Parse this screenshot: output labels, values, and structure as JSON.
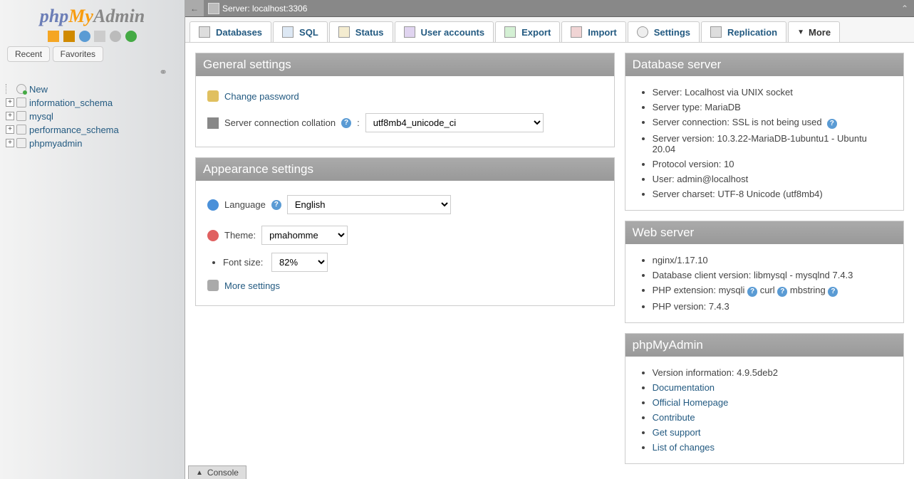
{
  "logo": {
    "part1": "php",
    "part2": "My",
    "part3": "Admin"
  },
  "sidebar": {
    "tabs": {
      "recent": "Recent",
      "favorites": "Favorites"
    },
    "new": "New",
    "databases": [
      "information_schema",
      "mysql",
      "performance_schema",
      "phpmyadmin"
    ]
  },
  "breadcrumb": {
    "back": "←",
    "server_label": "Server: localhost:3306"
  },
  "tabs": [
    {
      "label": "Databases"
    },
    {
      "label": "SQL"
    },
    {
      "label": "Status"
    },
    {
      "label": "User accounts"
    },
    {
      "label": "Export"
    },
    {
      "label": "Import"
    },
    {
      "label": "Settings"
    },
    {
      "label": "Replication"
    }
  ],
  "tabs_more": "More",
  "general": {
    "heading": "General settings",
    "change_pw": "Change password",
    "collation_label": "Server connection collation",
    "collation_value": "utf8mb4_unicode_ci"
  },
  "appearance": {
    "heading": "Appearance settings",
    "lang_label": "Language",
    "lang_value": "English",
    "theme_label": "Theme:",
    "theme_value": "pmahomme",
    "fontsize_label": "Font size:",
    "fontsize_value": "82%",
    "more": "More settings"
  },
  "dbserver": {
    "heading": "Database server",
    "items": [
      "Server: Localhost via UNIX socket",
      "Server type: MariaDB",
      "Server connection: SSL is not being used",
      "Server version: 10.3.22-MariaDB-1ubuntu1 - Ubuntu 20.04",
      "Protocol version: 10",
      "User: admin@localhost",
      "Server charset: UTF-8 Unicode (utf8mb4)"
    ]
  },
  "webserver": {
    "heading": "Web server",
    "items_plain": [
      "nginx/1.17.10",
      "Database client version: libmysql - mysqlnd 7.4.3"
    ],
    "phpext_label": "PHP extension:",
    "phpext_vals": [
      "mysqli",
      "curl",
      "mbstring"
    ],
    "phpver": "PHP version: 7.4.3"
  },
  "pma": {
    "heading": "phpMyAdmin",
    "version": "Version information: 4.9.5deb2",
    "links": [
      "Documentation",
      "Official Homepage",
      "Contribute",
      "Get support",
      "List of changes"
    ]
  },
  "console": "Console"
}
